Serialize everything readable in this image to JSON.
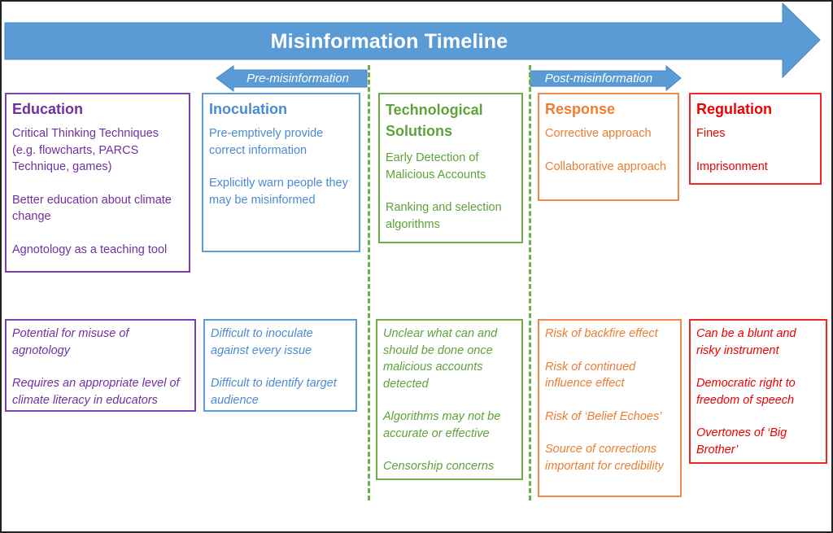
{
  "timeline": {
    "title": "Misinformation Timeline",
    "pre_label": "Pre-misinformation",
    "post_label": "Post-misinformation",
    "arrow_color": "#5b9bd5",
    "divider_color": "#70ad47"
  },
  "columns": [
    {
      "id": "education",
      "title": "Education",
      "color": "#7030a0",
      "solutions": [
        "Critical Thinking Techniques (e.g. flowcharts, PARCS Technique, games)",
        "Better education about climate change",
        "Agnotology as a teaching tool"
      ],
      "challenges": [
        "Potential for misuse of agnotology",
        "Requires an appropriate level of climate literacy in educators"
      ]
    },
    {
      "id": "inoculation",
      "title": "Inoculation",
      "color": "#5b9bd5",
      "solutions": [
        "Pre-emptively provide correct information",
        "Explicitly warn people they may be misinformed"
      ],
      "challenges": [
        "Difficult to inoculate against every issue",
        "Difficult to identify target audience"
      ]
    },
    {
      "id": "technological",
      "title": "Technological Solutions",
      "color": "#70ad47",
      "solutions": [
        "Early Detection of Malicious Accounts",
        "Ranking and selection algorithms"
      ],
      "challenges": [
        "Unclear what can and should be done once malicious accounts detected",
        "Algorithms may not be accurate or effective",
        "Censorship concerns"
      ]
    },
    {
      "id": "response",
      "title": "Response",
      "color": "#ed7d31",
      "solutions": [
        "Corrective approach",
        "Collaborative approach"
      ],
      "challenges": [
        "Risk of backfire effect",
        "Risk of continued influence effect",
        "Risk of ‘Belief Echoes’",
        "Source of corrections important for credibility"
      ]
    },
    {
      "id": "regulation",
      "title": "Regulation",
      "color": "#ff0000",
      "solutions": [
        "Fines",
        "Imprisonment"
      ],
      "challenges": [
        "Can be a blunt and risky instrument",
        "Democratic right to freedom of speech",
        "Overtones of ‘Big Brother’"
      ]
    }
  ]
}
